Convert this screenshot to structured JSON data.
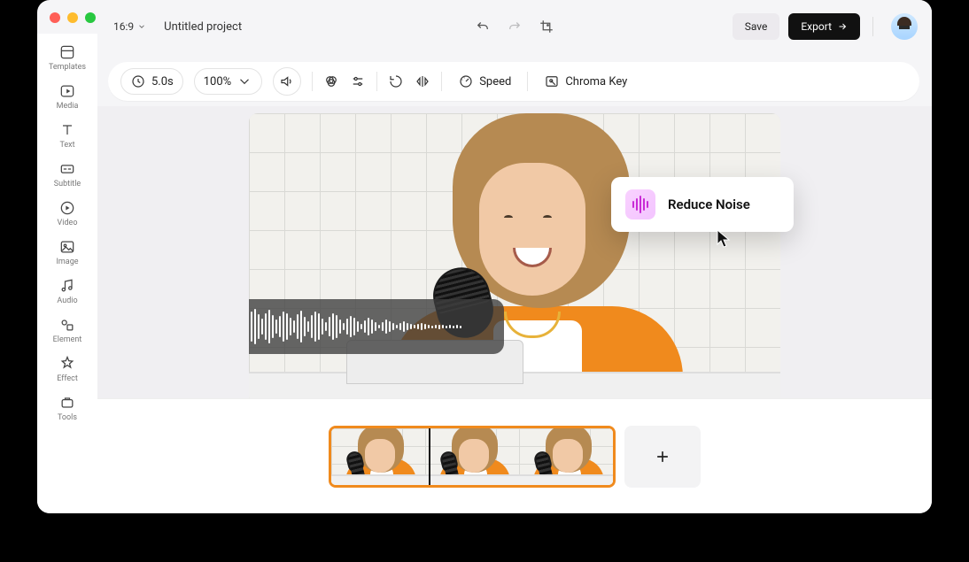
{
  "header": {
    "aspect_ratio": "16:9",
    "project_title": "Untitled project",
    "save_label": "Save",
    "export_label": "Export"
  },
  "sidebar": {
    "items": [
      {
        "label": "Templates"
      },
      {
        "label": "Media"
      },
      {
        "label": "Text"
      },
      {
        "label": "Subtitle"
      },
      {
        "label": "Video"
      },
      {
        "label": "Image"
      },
      {
        "label": "Audio"
      },
      {
        "label": "Element"
      },
      {
        "label": "Effect"
      },
      {
        "label": "Tools"
      }
    ]
  },
  "toolbar": {
    "duration": "5.0s",
    "zoom": "100%",
    "speed_label": "Speed",
    "chroma_label": "Chroma Key"
  },
  "overlay": {
    "reduce_noise_label": "Reduce Noise"
  },
  "timeline": {
    "clip_count": 3
  }
}
